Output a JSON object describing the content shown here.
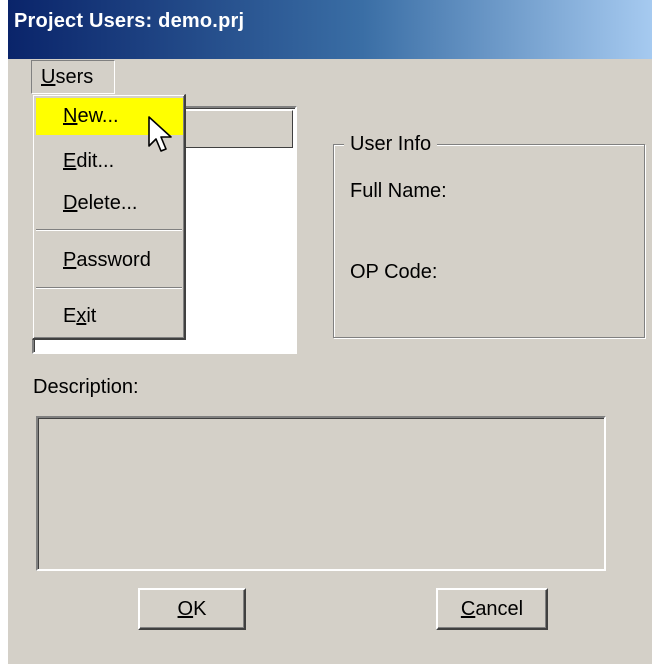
{
  "window": {
    "title": "Project Users: demo.prj"
  },
  "menubar": {
    "users": {
      "prefix": "",
      "mnemonic": "U",
      "rest": "sers"
    }
  },
  "menu": {
    "items": [
      {
        "prefix": "",
        "mnemonic": "N",
        "rest": "ew...",
        "highlighted": true
      },
      {
        "prefix": "",
        "mnemonic": "E",
        "rest": "dit...",
        "highlighted": false
      },
      {
        "prefix": "",
        "mnemonic": "D",
        "rest": "elete...",
        "highlighted": false
      },
      {
        "prefix": "",
        "mnemonic": "P",
        "rest": "assword",
        "highlighted": false
      },
      {
        "prefix": "E",
        "mnemonic": "x",
        "rest": "it",
        "highlighted": false
      }
    ]
  },
  "user_info": {
    "legend": "User Info",
    "full_name_label": "Full Name:",
    "op_code_label": "OP Code:"
  },
  "description": {
    "label": "Description:"
  },
  "buttons": {
    "ok": {
      "mnemonic": "O",
      "rest": "K"
    },
    "cancel": {
      "mnemonic": "C",
      "rest": "ancel"
    }
  },
  "colors": {
    "menu_highlight": "#ffff00",
    "title_start": "#0a246a",
    "title_end": "#a6caf0",
    "face": "#d4d0c8"
  },
  "icons": {
    "cursor": "arrow-pointer-icon"
  }
}
